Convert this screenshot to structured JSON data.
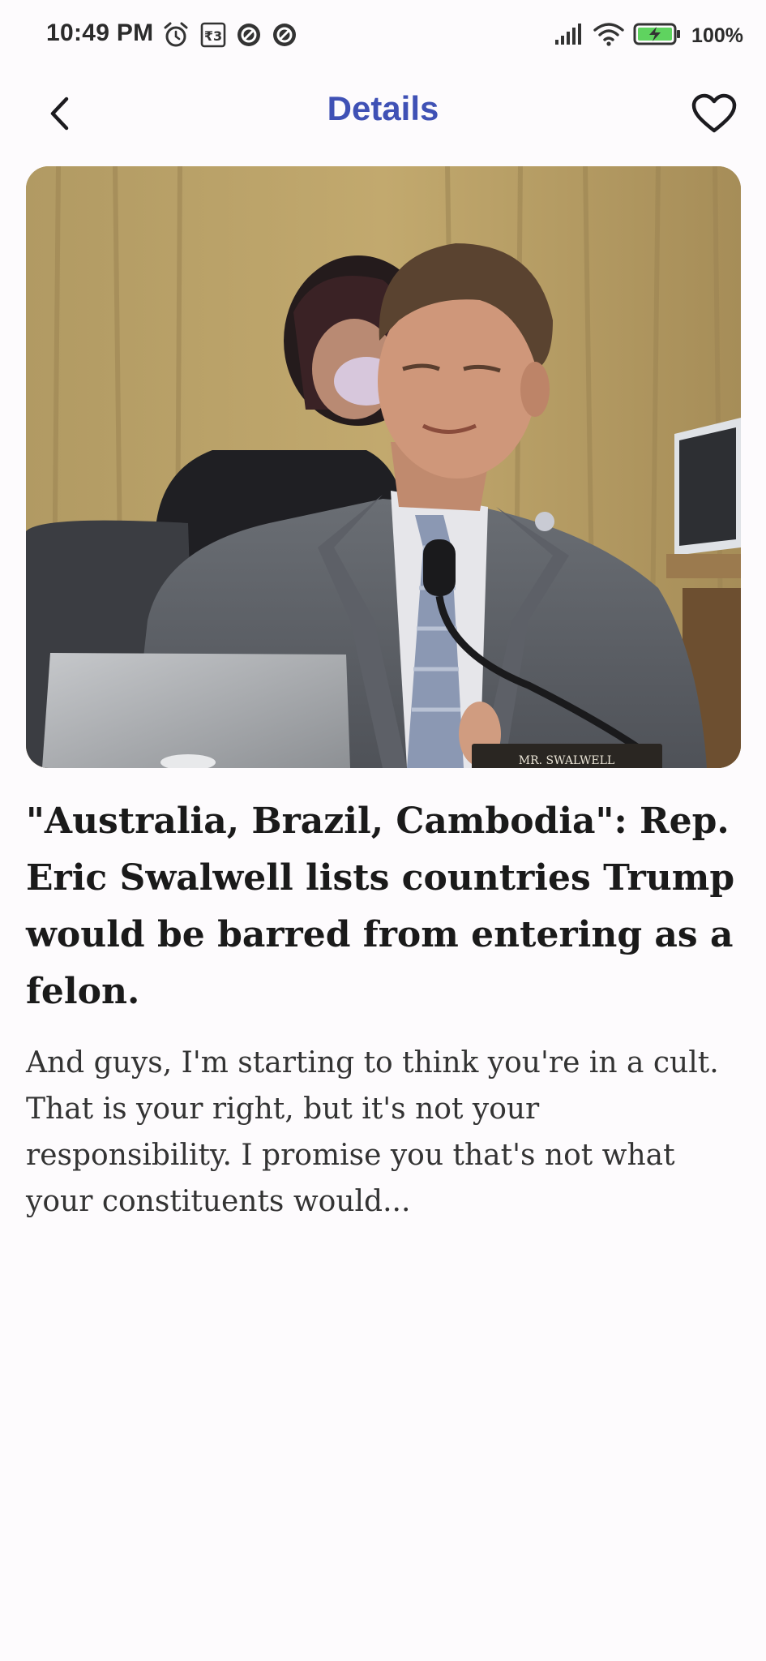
{
  "status_bar": {
    "time": "10:49 PM",
    "battery": "100%",
    "icons": [
      "alarm-icon",
      "rupee-icon",
      "app-notification-icon",
      "app-notification-icon",
      "signal-icon",
      "wifi-icon",
      "battery-charging-icon"
    ]
  },
  "app_bar": {
    "title": "Details",
    "back_icon": "chevron-left-icon",
    "favorite_icon": "heart-outline-icon",
    "accent_color": "#3f51b5"
  },
  "article": {
    "image_nameplate": "MR. SWALWELL",
    "headline": "\"Australia, Brazil, Cambodia\": Rep. Eric Swalwell lists countries Trump would be barred from entering as a felon.",
    "summary": "And guys, I'm starting to think you're in a cult. That is your right, but it's not your responsibility. I promise you that's not what your constituents would..."
  }
}
